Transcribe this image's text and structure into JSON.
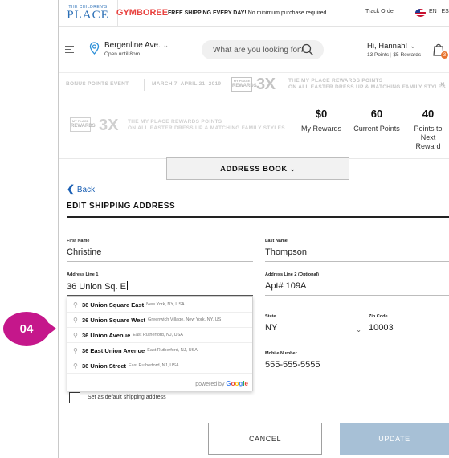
{
  "callout": {
    "label": "04",
    "color": "#c5178b"
  },
  "brand": {
    "tcp_small": "THE CHILDREN'S",
    "tcp_big": "PLACE",
    "gymboree": "GYMBOREE"
  },
  "topbar": {
    "free_shipping_bold": "FREE SHIPPING EVERY DAY!",
    "free_shipping_rest": " No minimum purchase required.",
    "track_order": "Track Order",
    "lang_en": "EN",
    "lang_sep": "|",
    "lang_es": "ES"
  },
  "header": {
    "store_name": "Bergenline Ave.",
    "store_chevron": "⌄",
    "store_hours": "Open until 8pm",
    "search_placeholder": "What are you looking for?",
    "greeting": "Hi, Hannah!",
    "greeting_chevron": "⌄",
    "points": "13 Points",
    "rewards": "$5 Rewards",
    "sep": "|",
    "bag_count": "3"
  },
  "promo": {
    "event": "BONUS POINTS EVENT",
    "dates": "MARCH 7–APRIL 21, 2019",
    "logo_top": "MY PLACE",
    "logo_mid": "REWARDS",
    "logo_bot": "",
    "multiplier": "3X",
    "line1": "THE MY PLACE REWARDS POINTS",
    "line2": "ON ALL EASTER DRESS UP & MATCHING FAMILY STYLES",
    "close": "×"
  },
  "rewards": {
    "multiplier": "3X",
    "line1": "THE MY PLACE REWARDS POINTS",
    "line2": "ON ALL EASTER DRESS UP & MATCHING FAMILY STYLES",
    "stats": [
      {
        "value": "$0",
        "label": "My Rewards"
      },
      {
        "value": "60",
        "label": "Current Points"
      },
      {
        "value": "40",
        "label": "Points to Next Reward"
      }
    ]
  },
  "address_book": {
    "label": "ADDRESS BOOK",
    "chevron": "⌄"
  },
  "back": {
    "chevron": "❮",
    "label": "Back"
  },
  "page_title": "EDIT SHIPPING ADDRESS",
  "form": {
    "first_name": {
      "label": "First Name",
      "value": "Christine"
    },
    "last_name": {
      "label": "Last Name",
      "value": "Thompson"
    },
    "address1": {
      "label": "Address Line 1",
      "value": "36 Union Sq. E"
    },
    "address2": {
      "label": "Address Line 2 (Optional)",
      "value": "Apt# 109A"
    },
    "state": {
      "label": "State",
      "value": "NY",
      "chevron": "⌄"
    },
    "zip": {
      "label": "Zip Code",
      "value": "10003"
    },
    "mobile": {
      "label": "Mobile Number",
      "value": "555-555-5555"
    },
    "default_checkbox_label": "Set as default shipping address"
  },
  "autocomplete": {
    "items": [
      {
        "main": "36 Union Square East",
        "secondary": "New York, NY, USA"
      },
      {
        "main": "36 Union Square West",
        "secondary": "Greenwich Village, New York, NY, US"
      },
      {
        "main": "36 Union Avenue",
        "secondary": "East Rutherford, NJ, USA"
      },
      {
        "main": "36 East Union Avenue",
        "secondary": "East Rutherford, NJ, USA"
      },
      {
        "main": "36 Union Street",
        "secondary": "East Rutherford, NJ, USA"
      }
    ],
    "powered_by": "powered by",
    "google": "Google"
  },
  "actions": {
    "cancel": "CANCEL",
    "update": "UPDATE"
  },
  "colors": {
    "tcp_blue": "#2b6fb6",
    "gymboree_red": "#e8423f",
    "link_blue": "#1a5fb4",
    "update_btn": "#a7c0d6"
  }
}
